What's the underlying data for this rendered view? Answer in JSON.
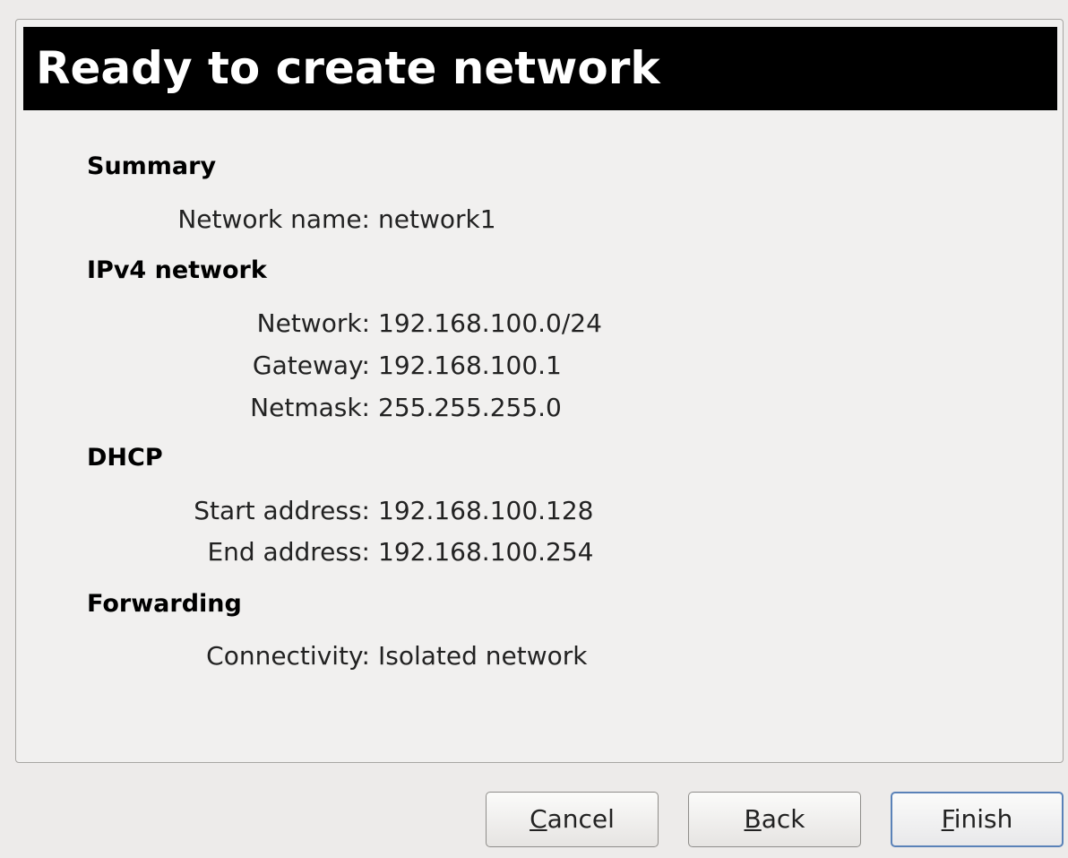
{
  "header": {
    "title": "Ready to create network"
  },
  "sections": {
    "summary": {
      "title": "Summary",
      "network_name_label": "Network name:",
      "network_name_value": "network1"
    },
    "ipv4": {
      "title": "IPv4 network",
      "network_label": "Network:",
      "network_value": "192.168.100.0/24",
      "gateway_label": "Gateway:",
      "gateway_value": "192.168.100.1",
      "netmask_label": "Netmask:",
      "netmask_value": "255.255.255.0"
    },
    "dhcp": {
      "title": "DHCP",
      "start_label": "Start address:",
      "start_value": "192.168.100.128",
      "end_label": "End address:",
      "end_value": "192.168.100.254"
    },
    "forwarding": {
      "title": "Forwarding",
      "connectivity_label": "Connectivity:",
      "connectivity_value": "Isolated network"
    }
  },
  "buttons": {
    "cancel": {
      "mnemonic": "C",
      "rest": "ancel"
    },
    "back": {
      "mnemonic": "B",
      "rest": "ack"
    },
    "finish": {
      "mnemonic": "F",
      "rest": "inish"
    }
  },
  "colors": {
    "title_bg": "#000000",
    "title_fg": "#ffffff",
    "dialog_bg": "#edebea",
    "focus_border": "#5a82b8"
  }
}
